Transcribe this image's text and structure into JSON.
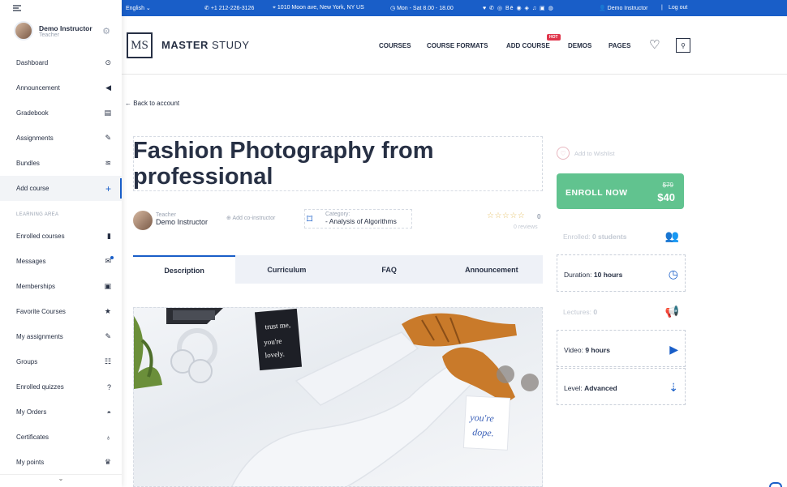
{
  "sidebar": {
    "user_name": "Demo Instructor",
    "user_role": "Teacher",
    "items": [
      {
        "label": "Dashboard",
        "icon": "⊙"
      },
      {
        "label": "Announcement",
        "icon": "◀"
      },
      {
        "label": "Gradebook",
        "icon": "▤"
      },
      {
        "label": "Assignments",
        "icon": "✎"
      },
      {
        "label": "Bundles",
        "icon": "≋"
      },
      {
        "label": "Add course",
        "icon": "+"
      }
    ],
    "area_label": "LEARNING AREA",
    "area_items": [
      {
        "label": "Enrolled courses",
        "icon": "▮"
      },
      {
        "label": "Messages",
        "icon": "✉"
      },
      {
        "label": "Memberships",
        "icon": "▣"
      },
      {
        "label": "Favorite Courses",
        "icon": "★"
      },
      {
        "label": "My assignments",
        "icon": "✎"
      },
      {
        "label": "Groups",
        "icon": "☷"
      },
      {
        "label": "Enrolled quizzes",
        "icon": "?"
      },
      {
        "label": "My Orders",
        "icon": "◓"
      },
      {
        "label": "Certificates",
        "icon": "♁"
      },
      {
        "label": "My points",
        "icon": "♛"
      }
    ]
  },
  "topbar": {
    "language": "English",
    "phone": "+1 212-226-3126",
    "address": "1010 Moon ave, New York, NY US",
    "hours": "Mon - Sat 8.00 - 18.00",
    "social": "♥ ✆ ◎ Bē ◉ ◈ ♫ ▣ ◍",
    "user": "Demo Instructor",
    "logout": "Log out"
  },
  "header": {
    "logo_mark": "MS",
    "logo_bold": "MASTER",
    "logo_light": "STUDY",
    "nav": [
      "COURSES",
      "COURSE FORMATS",
      "ADD COURSE",
      "DEMOS",
      "PAGES"
    ],
    "hot_badge": "HOT"
  },
  "course": {
    "back": "Back to account",
    "title": "Fashion Photography from professional",
    "teacher_label": "Teacher",
    "teacher_name": "Demo Instructor",
    "add_coinstructor": "Add co-instructor",
    "category_label": "Category:",
    "category_value": "- Analysis of Algorithms",
    "rating": "0",
    "reviews": "0 reviews",
    "tabs": [
      "Description",
      "Curriculum",
      "FAQ",
      "Announcement"
    ]
  },
  "side": {
    "wishlist": "Add to Wishlist",
    "enroll_label": "ENROLL NOW",
    "price_old": "$79",
    "price_new": "$40",
    "enrolled_label": "Enrolled:",
    "enrolled_value": "0 students",
    "duration_label": "Duration:",
    "duration_value": "10 hours",
    "lectures_label": "Lectures:",
    "lectures_value": "0",
    "video_label": "Video:",
    "video_value": "9 hours",
    "level_label": "Level:",
    "level_value": "Advanced"
  },
  "photo": {
    "card1": "trust me, you're lovely.",
    "card2": "you're dope."
  },
  "colors": {
    "brand": "#195ec8",
    "enroll": "#61c38f",
    "hot": "#e0354b"
  }
}
